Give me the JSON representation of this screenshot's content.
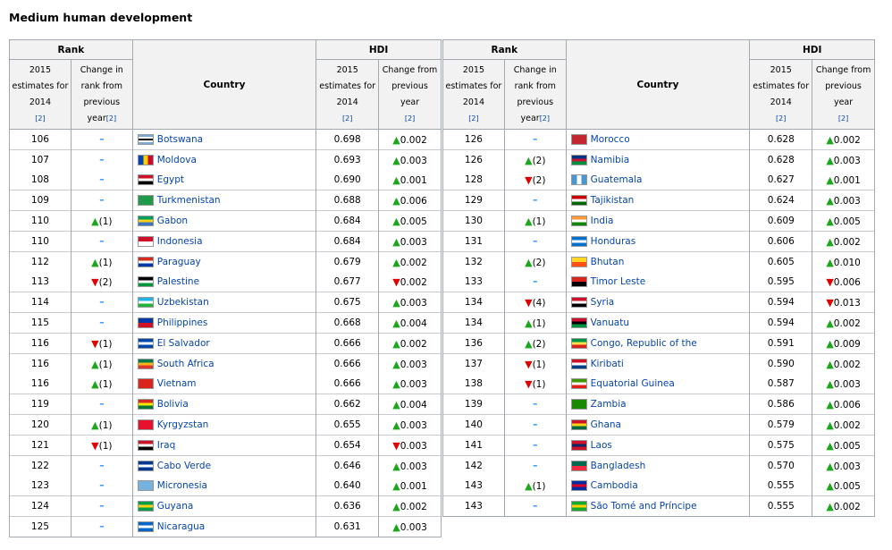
{
  "title": "Medium human development",
  "headers": {
    "rank": "Rank",
    "country": "Country",
    "hdi": "HDI",
    "est_line1": "2015",
    "est_line2": "estimates for",
    "est_line3": "2014",
    "change_rank_line1": "Change in",
    "change_rank_line2": "rank from",
    "change_rank_line3": "previous",
    "change_rank_line4": "year",
    "change_hdi_line1": "Change from",
    "change_hdi_line2": "previous",
    "change_hdi_line3": "year",
    "ref": "[2]"
  },
  "left_rows": [
    {
      "rank": "106",
      "chg": "",
      "chg_dir": "none",
      "country": "Botswana",
      "flag": [
        "#75aadb",
        "#ffffff",
        "#000000",
        "#ffffff",
        "#75aadb"
      ],
      "hdi": "0.698",
      "hdi_chg": "0.002",
      "hdi_dir": "up",
      "line": true
    },
    {
      "rank": "107",
      "chg": "",
      "chg_dir": "none",
      "country": "Moldova",
      "flag": [
        "#0046ae",
        "#ffd200",
        "#cc092f"
      ],
      "hdi": "0.693",
      "hdi_chg": "0.003",
      "hdi_dir": "up",
      "line": true,
      "vert": true
    },
    {
      "rank": "108",
      "chg": "",
      "chg_dir": "none",
      "country": "Egypt",
      "flag": [
        "#ce1126",
        "#ffffff",
        "#000000"
      ],
      "hdi": "0.690",
      "hdi_chg": "0.001",
      "hdi_dir": "up",
      "line": false
    },
    {
      "rank": "109",
      "chg": "",
      "chg_dir": "none",
      "country": "Turkmenistan",
      "flag": [
        "#1f9a48",
        "#1f9a48",
        "#1f9a48"
      ],
      "hdi": "0.688",
      "hdi_chg": "0.006",
      "hdi_dir": "up",
      "line": true
    },
    {
      "rank": "110",
      "chg": "(1)",
      "chg_dir": "up",
      "country": "Gabon",
      "flag": [
        "#009e60",
        "#fcd116",
        "#3a75c4"
      ],
      "hdi": "0.684",
      "hdi_chg": "0.005",
      "hdi_dir": "up",
      "line": true
    },
    {
      "rank": "110",
      "chg": "",
      "chg_dir": "none",
      "country": "Indonesia",
      "flag": [
        "#ce1126",
        "#ffffff"
      ],
      "hdi": "0.684",
      "hdi_chg": "0.003",
      "hdi_dir": "up",
      "line": true
    },
    {
      "rank": "112",
      "chg": "(1)",
      "chg_dir": "up",
      "country": "Paraguay",
      "flag": [
        "#d52b1e",
        "#ffffff",
        "#0038a8"
      ],
      "hdi": "0.679",
      "hdi_chg": "0.002",
      "hdi_dir": "up",
      "line": true
    },
    {
      "rank": "113",
      "chg": "(2)",
      "chg_dir": "down",
      "country": "Palestine",
      "flag": [
        "#000000",
        "#ffffff",
        "#009639"
      ],
      "hdi": "0.677",
      "hdi_chg": "0.002",
      "hdi_dir": "down",
      "line": false
    },
    {
      "rank": "114",
      "chg": "",
      "chg_dir": "none",
      "country": "Uzbekistan",
      "flag": [
        "#1eb4e6",
        "#ffffff",
        "#1eb53a"
      ],
      "hdi": "0.675",
      "hdi_chg": "0.003",
      "hdi_dir": "up",
      "line": true
    },
    {
      "rank": "115",
      "chg": "",
      "chg_dir": "none",
      "country": "Philippines",
      "flag": [
        "#0038a8",
        "#ce1126"
      ],
      "hdi": "0.668",
      "hdi_chg": "0.004",
      "hdi_dir": "up",
      "line": true
    },
    {
      "rank": "116",
      "chg": "(1)",
      "chg_dir": "down",
      "country": "El Salvador",
      "flag": [
        "#0047ab",
        "#ffffff",
        "#0047ab"
      ],
      "hdi": "0.666",
      "hdi_chg": "0.002",
      "hdi_dir": "up",
      "line": true
    },
    {
      "rank": "116",
      "chg": "(1)",
      "chg_dir": "up",
      "country": "South Africa",
      "flag": [
        "#007a4d",
        "#ffb612",
        "#de3831"
      ],
      "hdi": "0.666",
      "hdi_chg": "0.003",
      "hdi_dir": "up",
      "line": true
    },
    {
      "rank": "116",
      "chg": "(1)",
      "chg_dir": "up",
      "country": "Vietnam",
      "flag": [
        "#da251d",
        "#da251d"
      ],
      "hdi": "0.666",
      "hdi_chg": "0.003",
      "hdi_dir": "up",
      "line": false
    },
    {
      "rank": "119",
      "chg": "",
      "chg_dir": "none",
      "country": "Bolivia",
      "flag": [
        "#d52b1e",
        "#f9e300",
        "#007934"
      ],
      "hdi": "0.662",
      "hdi_chg": "0.004",
      "hdi_dir": "up",
      "line": true
    },
    {
      "rank": "120",
      "chg": "(1)",
      "chg_dir": "up",
      "country": "Kyrgyzstan",
      "flag": [
        "#e8112d",
        "#e8112d"
      ],
      "hdi": "0.655",
      "hdi_chg": "0.003",
      "hdi_dir": "up",
      "line": true
    },
    {
      "rank": "121",
      "chg": "(1)",
      "chg_dir": "down",
      "country": "Iraq",
      "flag": [
        "#ce1126",
        "#ffffff",
        "#000000"
      ],
      "hdi": "0.654",
      "hdi_chg": "0.003",
      "hdi_dir": "down",
      "line": true
    },
    {
      "rank": "122",
      "chg": "",
      "chg_dir": "none",
      "country": "Cabo Verde",
      "flag": [
        "#003893",
        "#ffffff",
        "#003893"
      ],
      "hdi": "0.646",
      "hdi_chg": "0.003",
      "hdi_dir": "up",
      "line": true
    },
    {
      "rank": "123",
      "chg": "",
      "chg_dir": "none",
      "country": "Micronesia",
      "flag": [
        "#75b2dd",
        "#75b2dd"
      ],
      "hdi": "0.640",
      "hdi_chg": "0.001",
      "hdi_dir": "up",
      "line": false
    },
    {
      "rank": "124",
      "chg": "",
      "chg_dir": "none",
      "country": "Guyana",
      "flag": [
        "#009e49",
        "#fcd116",
        "#009e49"
      ],
      "hdi": "0.636",
      "hdi_chg": "0.002",
      "hdi_dir": "up",
      "line": true
    },
    {
      "rank": "125",
      "chg": "",
      "chg_dir": "none",
      "country": "Nicaragua",
      "flag": [
        "#0067c6",
        "#ffffff",
        "#0067c6"
      ],
      "hdi": "0.631",
      "hdi_chg": "0.003",
      "hdi_dir": "up",
      "line": true
    }
  ],
  "right_rows": [
    {
      "rank": "126",
      "chg": "",
      "chg_dir": "none",
      "country": "Morocco",
      "flag": [
        "#c1272d",
        "#c1272d"
      ],
      "hdi": "0.628",
      "hdi_chg": "0.002",
      "hdi_dir": "up",
      "line": true
    },
    {
      "rank": "126",
      "chg": "(2)",
      "chg_dir": "up",
      "country": "Namibia",
      "flag": [
        "#003580",
        "#d21034",
        "#009543"
      ],
      "hdi": "0.628",
      "hdi_chg": "0.003",
      "hdi_dir": "up",
      "line": true
    },
    {
      "rank": "128",
      "chg": "(2)",
      "chg_dir": "down",
      "country": "Guatemala",
      "flag": [
        "#4997d0",
        "#ffffff",
        "#4997d0"
      ],
      "hdi": "0.627",
      "hdi_chg": "0.001",
      "hdi_dir": "up",
      "line": false,
      "vert": true
    },
    {
      "rank": "129",
      "chg": "",
      "chg_dir": "none",
      "country": "Tajikistan",
      "flag": [
        "#cc0000",
        "#ffffff",
        "#006600"
      ],
      "hdi": "0.624",
      "hdi_chg": "0.003",
      "hdi_dir": "up",
      "line": true
    },
    {
      "rank": "130",
      "chg": "(1)",
      "chg_dir": "up",
      "country": "India",
      "flag": [
        "#ff9933",
        "#ffffff",
        "#138808"
      ],
      "hdi": "0.609",
      "hdi_chg": "0.005",
      "hdi_dir": "up",
      "line": true
    },
    {
      "rank": "131",
      "chg": "",
      "chg_dir": "none",
      "country": "Honduras",
      "flag": [
        "#0073cf",
        "#ffffff",
        "#0073cf"
      ],
      "hdi": "0.606",
      "hdi_chg": "0.002",
      "hdi_dir": "up",
      "line": true
    },
    {
      "rank": "132",
      "chg": "(2)",
      "chg_dir": "up",
      "country": "Bhutan",
      "flag": [
        "#ffd520",
        "#ff4e12"
      ],
      "hdi": "0.605",
      "hdi_chg": "0.010",
      "hdi_dir": "up",
      "line": true
    },
    {
      "rank": "133",
      "chg": "",
      "chg_dir": "none",
      "country": "Timor Leste",
      "flag": [
        "#dc241f",
        "#000000"
      ],
      "hdi": "0.595",
      "hdi_chg": "0.006",
      "hdi_dir": "down",
      "line": false
    },
    {
      "rank": "134",
      "chg": "(4)",
      "chg_dir": "down",
      "country": "Syria",
      "flag": [
        "#ce1126",
        "#ffffff",
        "#000000"
      ],
      "hdi": "0.594",
      "hdi_chg": "0.013",
      "hdi_dir": "down",
      "line": true
    },
    {
      "rank": "134",
      "chg": "(1)",
      "chg_dir": "up",
      "country": "Vanuatu",
      "flag": [
        "#d21034",
        "#000000",
        "#009543"
      ],
      "hdi": "0.594",
      "hdi_chg": "0.002",
      "hdi_dir": "up",
      "line": true
    },
    {
      "rank": "136",
      "chg": "(2)",
      "chg_dir": "up",
      "country": "Congo, Republic of the",
      "flag": [
        "#009543",
        "#fbde4a",
        "#dc241f"
      ],
      "hdi": "0.591",
      "hdi_chg": "0.009",
      "hdi_dir": "up",
      "line": true
    },
    {
      "rank": "137",
      "chg": "(1)",
      "chg_dir": "down",
      "country": "Kiribati",
      "flag": [
        "#ce1126",
        "#ffffff",
        "#003f87"
      ],
      "hdi": "0.590",
      "hdi_chg": "0.002",
      "hdi_dir": "up",
      "line": true
    },
    {
      "rank": "138",
      "chg": "(1)",
      "chg_dir": "down",
      "country": "Equatorial Guinea",
      "flag": [
        "#3e9a00",
        "#ffffff",
        "#e32118"
      ],
      "hdi": "0.587",
      "hdi_chg": "0.003",
      "hdi_dir": "up",
      "line": false
    },
    {
      "rank": "139",
      "chg": "",
      "chg_dir": "none",
      "country": "Zambia",
      "flag": [
        "#198a00",
        "#198a00"
      ],
      "hdi": "0.586",
      "hdi_chg": "0.006",
      "hdi_dir": "up",
      "line": true
    },
    {
      "rank": "140",
      "chg": "",
      "chg_dir": "none",
      "country": "Ghana",
      "flag": [
        "#ce1126",
        "#fcd116",
        "#006b3f"
      ],
      "hdi": "0.579",
      "hdi_chg": "0.002",
      "hdi_dir": "up",
      "line": true
    },
    {
      "rank": "141",
      "chg": "",
      "chg_dir": "none",
      "country": "Laos",
      "flag": [
        "#ce1126",
        "#002868",
        "#ce1126"
      ],
      "hdi": "0.575",
      "hdi_chg": "0.005",
      "hdi_dir": "up",
      "line": true
    },
    {
      "rank": "142",
      "chg": "",
      "chg_dir": "none",
      "country": "Bangladesh",
      "flag": [
        "#006a4e",
        "#f42a41"
      ],
      "hdi": "0.570",
      "hdi_chg": "0.003",
      "hdi_dir": "up",
      "line": true
    },
    {
      "rank": "143",
      "chg": "(1)",
      "chg_dir": "up",
      "country": "Cambodia",
      "flag": [
        "#032ea1",
        "#e00025",
        "#032ea1"
      ],
      "hdi": "0.555",
      "hdi_chg": "0.005",
      "hdi_dir": "up",
      "line": false
    },
    {
      "rank": "143",
      "chg": "",
      "chg_dir": "none",
      "country": "São Tomé and Príncipe",
      "flag": [
        "#12ad2b",
        "#ffce00",
        "#12ad2b"
      ],
      "hdi": "0.555",
      "hdi_chg": "0.002",
      "hdi_dir": "up",
      "line": true
    }
  ],
  "symbols": {
    "dash": "–",
    "up": "▲",
    "down": "▼"
  }
}
